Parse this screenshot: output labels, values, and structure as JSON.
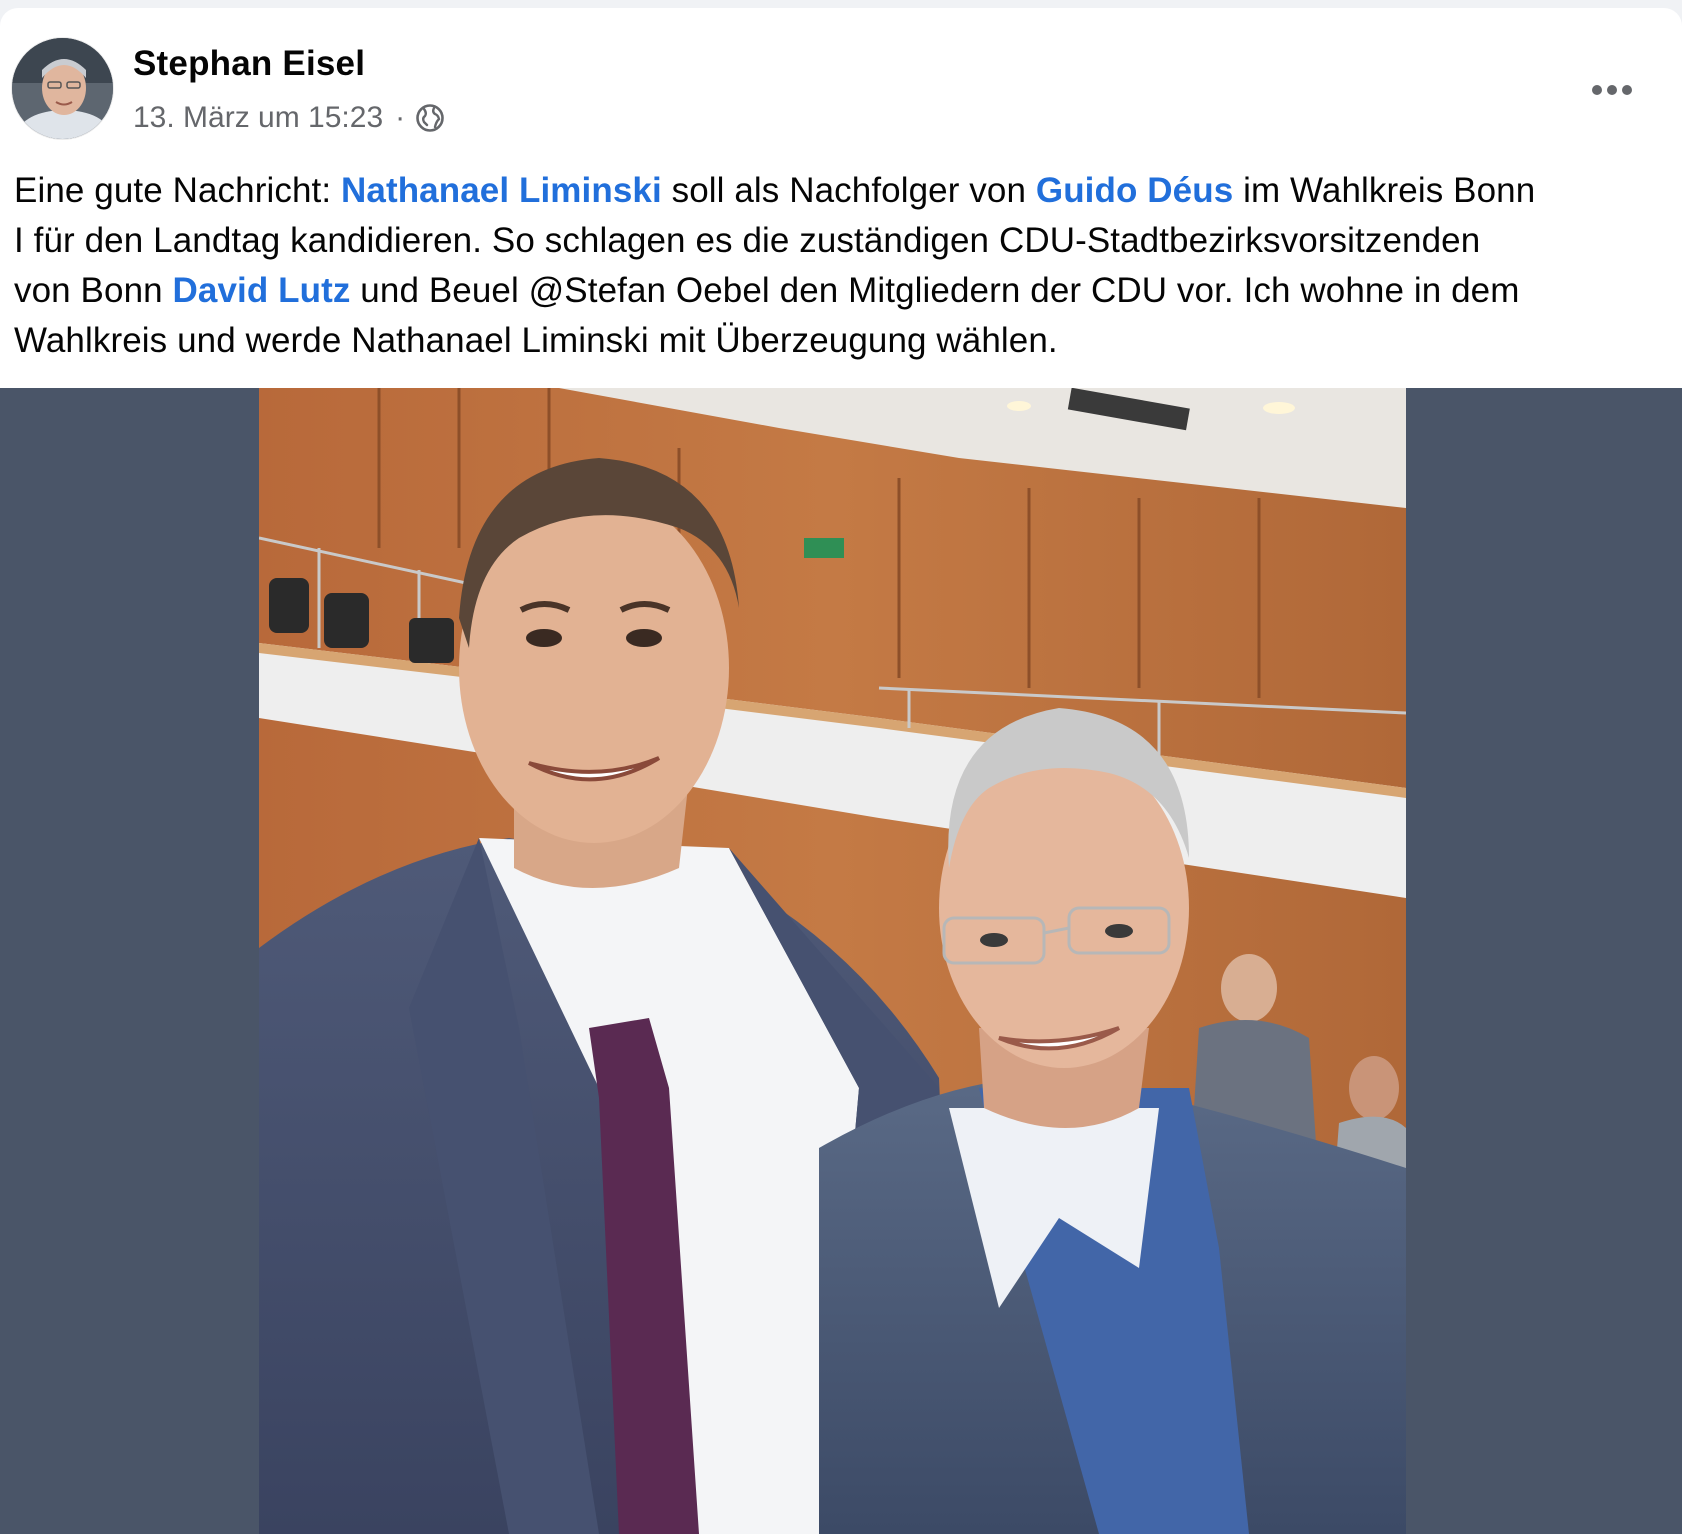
{
  "post": {
    "author": "Stephan Eisel",
    "timestamp": "13. März um 15:23",
    "separator": "·",
    "privacy_icon": "globe-icon",
    "more_icon": "more-options-icon",
    "text": {
      "l1_a": "Eine gute Nachricht: ",
      "l1_m1": "Nathanael Liminski",
      "l1_b": " soll als Nachfolger von ",
      "l1_m2": "Guido Déus",
      "l1_c": " im Wahlkreis Bonn",
      "l2": "I  für den Landtag kandidieren. So schlagen es die zuständigen CDU-Stadtbezirksvorsitzenden",
      "l3_a": "von  Bonn ",
      "l3_m3": "David Lutz",
      "l3_b": " und Beuel @Stefan Oebel den Mitgliedern der CDU vor. Ich wohne in dem",
      "l4": "Wahlkreis und werde Nathanael Liminski mit Überzeugung wählen."
    }
  },
  "colors": {
    "mention": "#216fdb",
    "media_backdrop": "#4a5568",
    "meta_text": "#65676b"
  }
}
